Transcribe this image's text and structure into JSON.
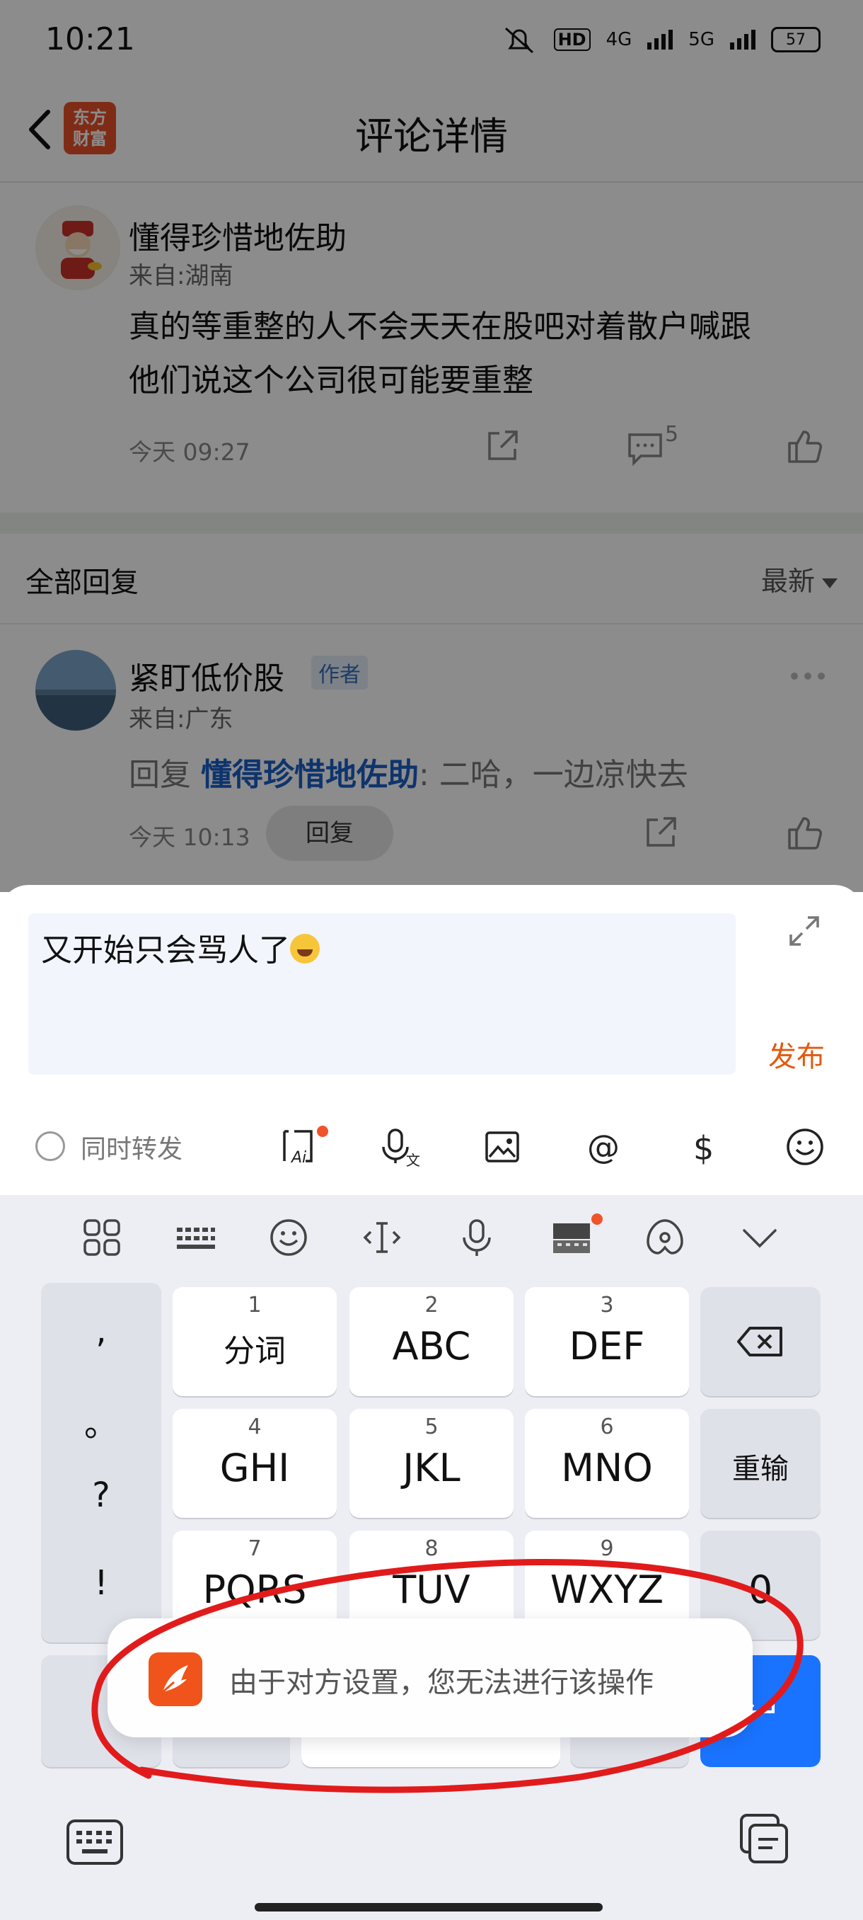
{
  "status_bar": {
    "time": "10:21",
    "hd": "HD",
    "net1": "4G",
    "net2": "5G",
    "battery": "57"
  },
  "header": {
    "back": "back",
    "logo_line1": "东方",
    "logo_line2": "财富",
    "title": "评论详情"
  },
  "comment": {
    "username": "懂得珍惜地佐助",
    "from": "来自:湖南",
    "text_line1": "真的等重整的人不会天天在股吧对着散户喊跟",
    "text_line2": "他们说这个公司很可能要重整",
    "time": "今天 09:27",
    "reply_count": "5"
  },
  "replies_section": {
    "title": "全部回复",
    "sort": "最新"
  },
  "reply": {
    "username": "紧盯低价股",
    "tag": "作者",
    "from": "来自:广东",
    "prefix": "回复 ",
    "mention": "懂得珍惜地佐助",
    "text": ": 二哈，一边凉快去",
    "time": "今天 10:13",
    "reply_button": "回复"
  },
  "composer": {
    "input_value": "又开始只会骂人了",
    "publish": "发布",
    "sync_forward": "同时转发"
  },
  "keyboard": {
    "punctuation": [
      ",",
      "。",
      "?",
      "!"
    ],
    "keys": [
      {
        "num": "1",
        "label": "分词"
      },
      {
        "num": "2",
        "label": "ABC"
      },
      {
        "num": "3",
        "label": "DEF"
      },
      {
        "num": "4",
        "label": "GHI"
      },
      {
        "num": "5",
        "label": "JKL"
      },
      {
        "num": "6",
        "label": "MNO"
      },
      {
        "num": "7",
        "label": "PQRS"
      },
      {
        "num": "8",
        "label": "TUV"
      },
      {
        "num": "9",
        "label": "WXYZ"
      }
    ],
    "reenter": "重输",
    "zero": "0"
  },
  "toast": {
    "message": "由于对方设置，您无法进行该操作"
  },
  "colors": {
    "accent_orange": "#e25a12",
    "mention_blue": "#1a5fc7",
    "enter_blue": "#1a73ff",
    "annotation_red": "#e11b1b"
  }
}
